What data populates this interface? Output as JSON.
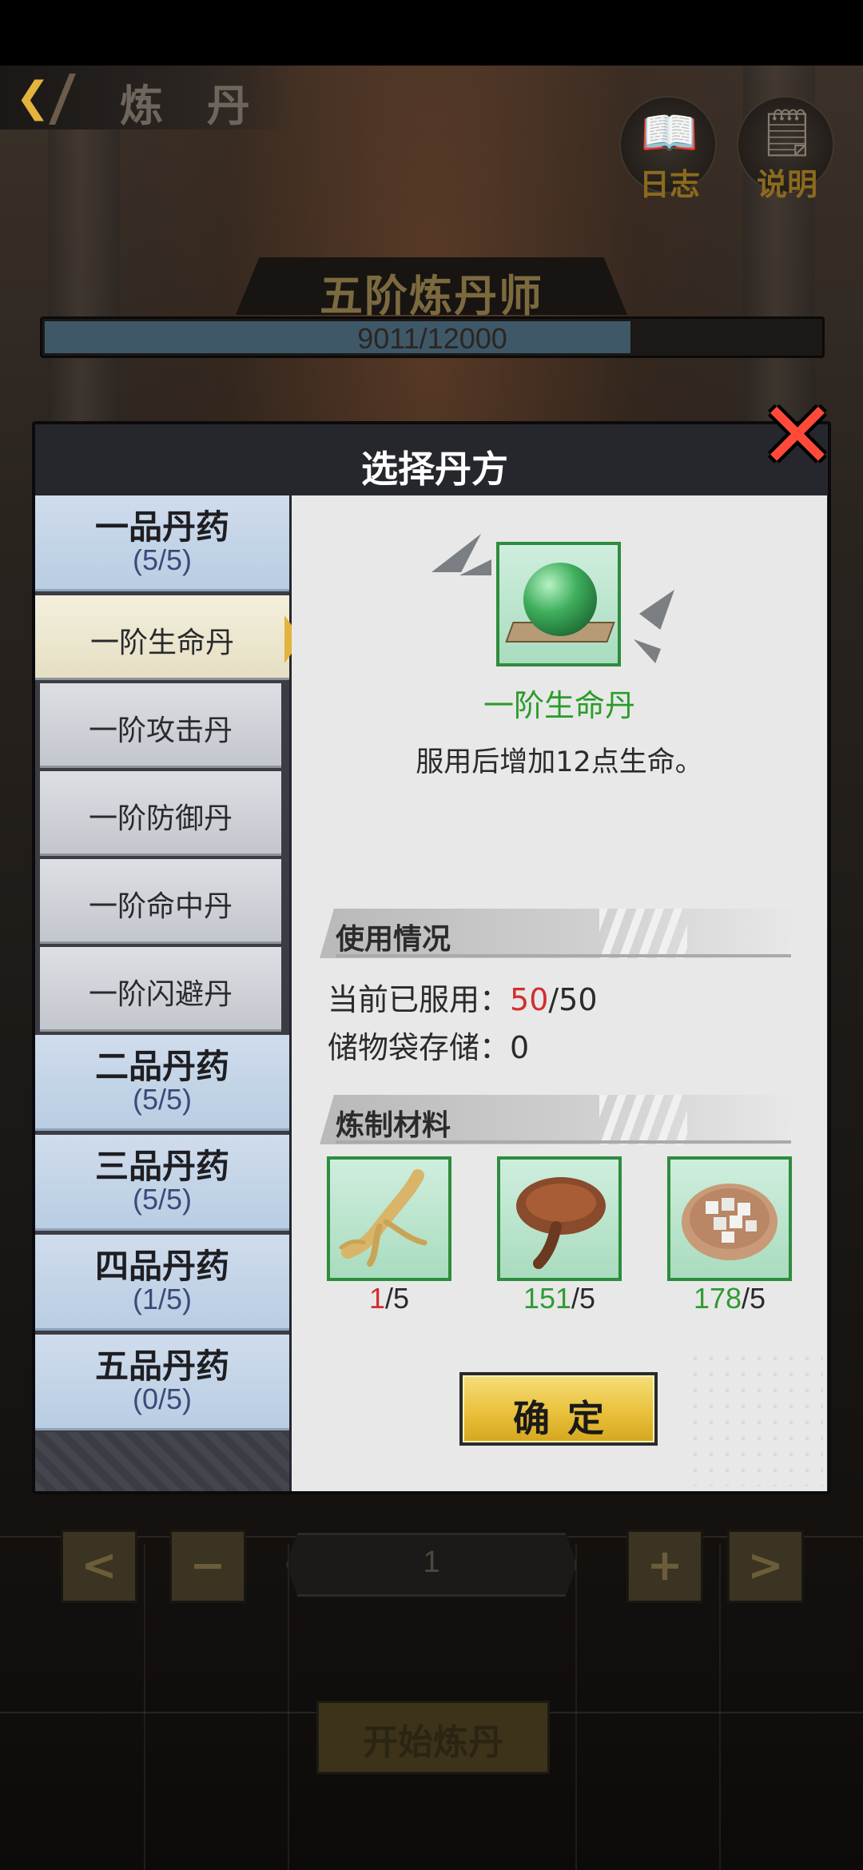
{
  "header": {
    "back_icon": "chevron-left-icon",
    "title": "炼 丹",
    "log_button": {
      "icon": "book-icon",
      "label": "日志"
    },
    "help_button": {
      "icon": "notepad-icon",
      "label": "说明"
    }
  },
  "rank": {
    "title": "五阶炼丹师",
    "exp_text": "9011/12000",
    "exp_current": 9011,
    "exp_max": 12000
  },
  "dialog": {
    "title": "选择丹方",
    "close_icon": "close-x-icon",
    "categories": [
      {
        "name": "一品丹药",
        "count": "(5/5)"
      },
      {
        "name": "二品丹药",
        "count": "(5/5)"
      },
      {
        "name": "三品丹药",
        "count": "(5/5)"
      },
      {
        "name": "四品丹药",
        "count": "(1/5)"
      },
      {
        "name": "五品丹药",
        "count": "(0/5)"
      }
    ],
    "recipes": [
      {
        "label": "一阶生命丹",
        "selected": true
      },
      {
        "label": "一阶攻击丹",
        "selected": false
      },
      {
        "label": "一阶防御丹",
        "selected": false
      },
      {
        "label": "一阶命中丹",
        "selected": false
      },
      {
        "label": "一阶闪避丹",
        "selected": false
      }
    ],
    "item": {
      "name": "一阶生命丹",
      "description": "服用后增加12点生命。",
      "icon": "green-orb-pill-icon"
    },
    "usage": {
      "header": "使用情况",
      "consumed_label": "当前已服用：",
      "consumed_value": "50",
      "consumed_max": "/50",
      "storage_label": "储物袋存储：",
      "storage_value": "0"
    },
    "materials": {
      "header": "炼制材料",
      "items": [
        {
          "icon": "ginseng-root-icon",
          "have": "1",
          "need": "/5",
          "sufficient": false
        },
        {
          "icon": "lingzhi-mushroom-icon",
          "have": "151",
          "need": "/5",
          "sufficient": true
        },
        {
          "icon": "white-cubes-bowl-icon",
          "have": "178",
          "need": "/5",
          "sufficient": true
        }
      ]
    },
    "confirm_label": "确定"
  },
  "controls": {
    "prev_label": "<",
    "minus_label": "−",
    "quantity": "1",
    "plus_label": "+",
    "next_label": ">",
    "start_label": "开始炼丹"
  },
  "colors": {
    "accent_gold": "#e9c13c",
    "selected_green": "#2a9c2a",
    "insufficient_red": "#d22e2e",
    "category_blue": "#c4d5e9"
  }
}
